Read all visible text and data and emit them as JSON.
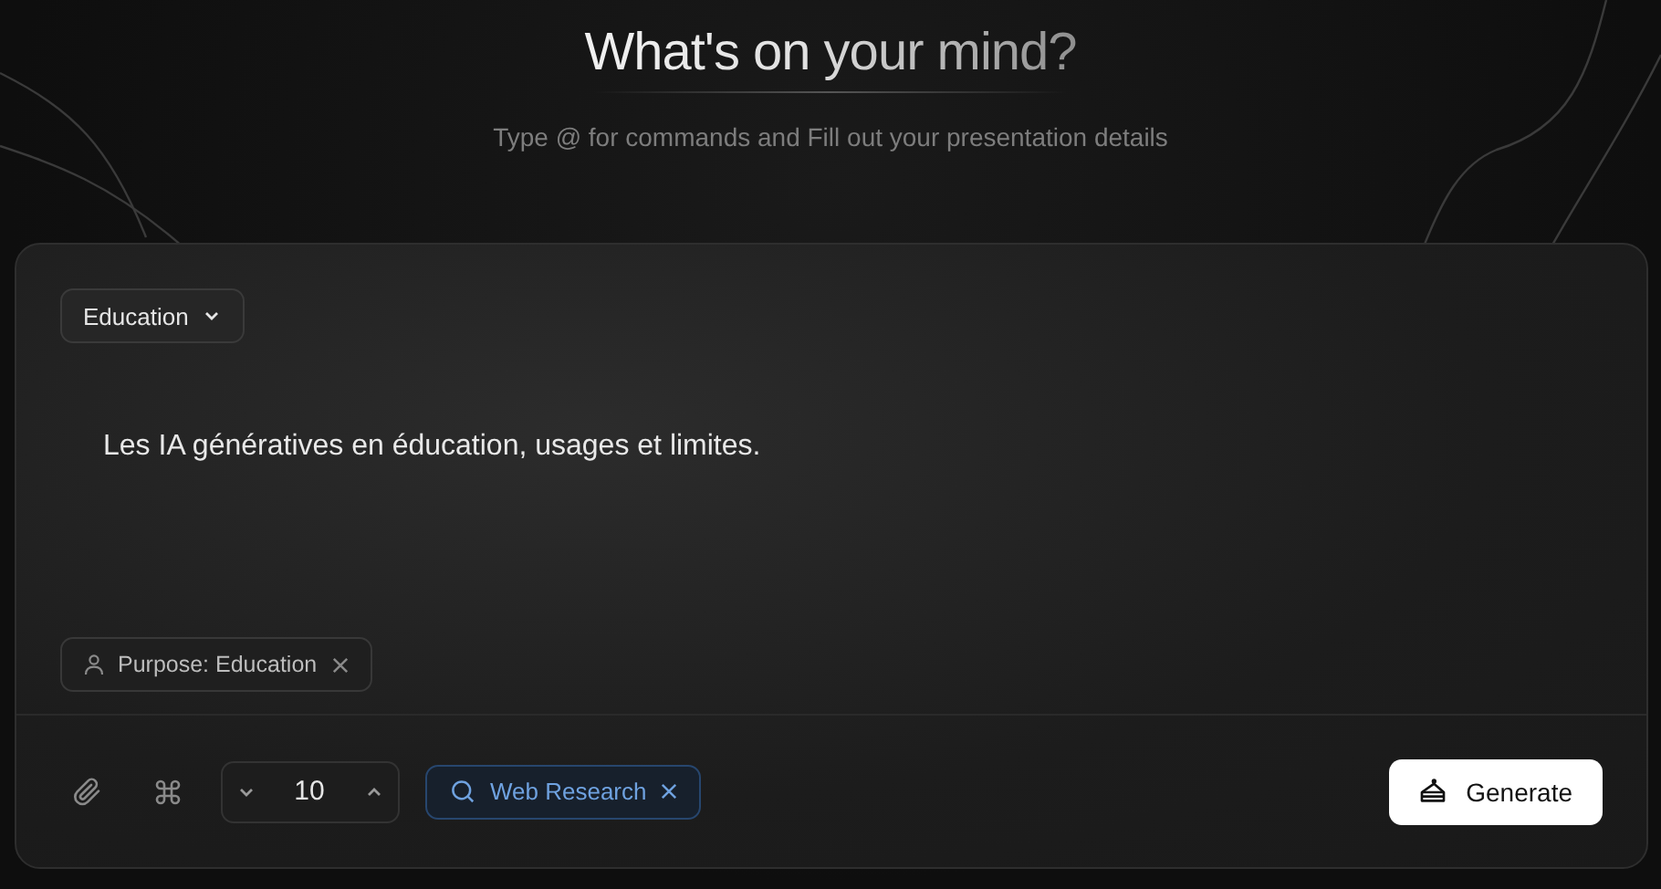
{
  "heading": "What's on your mind?",
  "subtitle": "Type @ for commands and Fill out your presentation details",
  "category": {
    "label": "Education"
  },
  "prompt": {
    "value": "Les IA génératives en éducation, usages et limites."
  },
  "chips": [
    {
      "label": "Purpose: Education"
    }
  ],
  "slide_count": {
    "value": "10"
  },
  "tools": [
    {
      "label": "Web Research",
      "active": true
    }
  ],
  "generate_button": {
    "label": "Generate"
  }
}
